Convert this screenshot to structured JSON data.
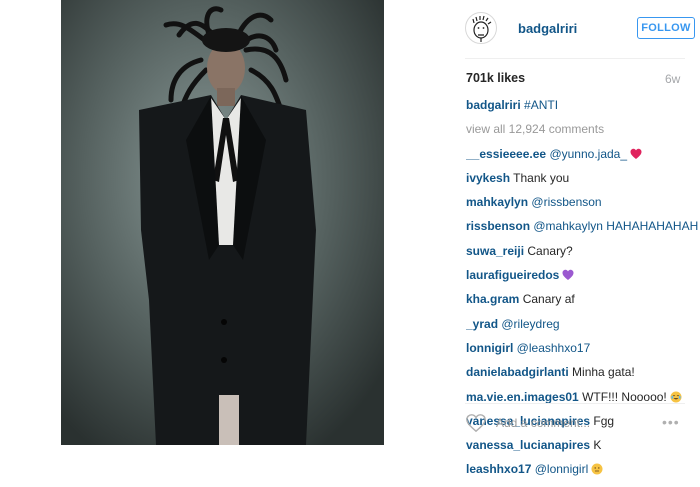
{
  "post": {
    "photo_alt": "portrait photo"
  },
  "header": {
    "username": "badgalriri",
    "follow_label": "FOLLOW"
  },
  "stats": {
    "likes": "701k likes",
    "age": "6w"
  },
  "caption": {
    "user": "badgalriri",
    "text": "#ANTI"
  },
  "view_all": "view all 12,924 comments",
  "comments": [
    {
      "user": "__essieeee.ee",
      "text": "@yunno.jada_",
      "emoji": "red-heart"
    },
    {
      "user": "ivykesh",
      "text": "Thank you",
      "emoji": ""
    },
    {
      "user": "mahkaylyn",
      "text": "@rissbenson",
      "emoji": ""
    },
    {
      "user": "rissbenson",
      "text": "@mahkaylyn HAHAHAHAHAHA",
      "emoji": ""
    },
    {
      "user": "suwa_reiji",
      "text": "Canary?",
      "emoji": ""
    },
    {
      "user": "laurafigueiredos",
      "text": "",
      "emoji": "purple-heart"
    },
    {
      "user": "kha.gram",
      "text": "Canary af",
      "emoji": ""
    },
    {
      "user": "_yrad",
      "text": "@rileydreg",
      "emoji": ""
    },
    {
      "user": "lonnigirl",
      "text": "@leashhxo17",
      "emoji": ""
    },
    {
      "user": "danielabadgirlanti",
      "text": "Minha gata!",
      "emoji": ""
    },
    {
      "user": "ma.vie.en.images01",
      "text": "WTF!!! Nooooo!",
      "emoji": "crying-face"
    },
    {
      "user": "vanessa_lucianapires",
      "text": "Fgg",
      "emoji": ""
    },
    {
      "user": "vanessa_lucianapires",
      "text": "K",
      "emoji": ""
    },
    {
      "user": "leashhxo17",
      "text": "@lonnigirl",
      "emoji": "neutral-face"
    }
  ],
  "footer": {
    "add_comment_placeholder": "Add a comment...",
    "more_label": "•••"
  },
  "colors": {
    "username_blue": "#125688",
    "follow_blue": "#3897f0",
    "muted": "#999999"
  }
}
